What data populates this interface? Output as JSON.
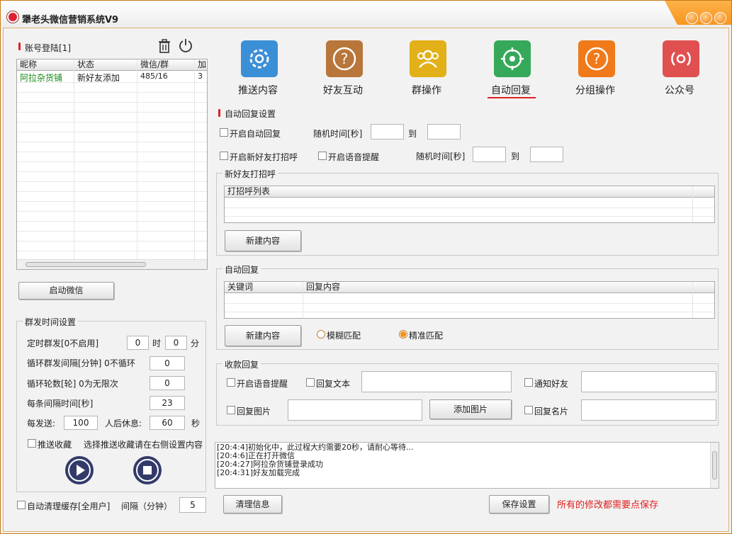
{
  "window": {
    "title": "犟老头微信营销系统V9"
  },
  "account": {
    "title": "账号登陆[1]",
    "columns": [
      "昵称",
      "状态",
      "微信/群",
      "加"
    ],
    "rows": [
      {
        "name": "阿拉杂货铺",
        "status": "新好友添加",
        "count": "485/16",
        "extra": "3"
      }
    ],
    "start_label": "启动微信"
  },
  "broadcast": {
    "title": "群发时间设置",
    "timed_label": "定时群发[0不启用]",
    "hour_value": "0",
    "hour_unit": "时",
    "min_value": "0",
    "min_unit": "分",
    "interval_label": "循环群发间隔[分钟] 0不循环",
    "interval_value": "0",
    "rounds_label": "循环轮数[轮] 0为无限次",
    "rounds_value": "0",
    "gap_label": "每条间隔时间[秒]",
    "gap_value": "23",
    "send_label": "每发送:",
    "send_value": "100",
    "rest_label": "人后休息:",
    "rest_value": "60",
    "rest_unit": "秒",
    "fav_label": "推送收藏",
    "fav_hint": "选择推送收藏请在右侧设置内容"
  },
  "cache": {
    "label": "自动清理缓存[全用户]",
    "interval_label": "间隔（分钟）",
    "interval_value": "5"
  },
  "tabs": [
    {
      "label": "推送内容",
      "color": "#3b8fd6",
      "icon": "gear-icon"
    },
    {
      "label": "好友互动",
      "color": "#b8763a",
      "icon": "question-icon"
    },
    {
      "label": "群操作",
      "color": "#e2b018",
      "icon": "group-icon"
    },
    {
      "label": "自动回复",
      "color": "#36a85a",
      "icon": "target-icon"
    },
    {
      "label": "分组操作",
      "color": "#f07a1a",
      "icon": "question-icon"
    },
    {
      "label": "公众号",
      "color": "#e05050",
      "icon": "broadcast-icon"
    }
  ],
  "auto_reply": {
    "section_title": "自动回复设置",
    "enable_label": "开启自动回复",
    "random_label": "随机时间[秒]",
    "to_label": "到",
    "greet_label": "开启新好友打招呼",
    "voice_label": "开启语音提醒",
    "random2_label": "随机时间[秒]",
    "to2_label": "到",
    "greet_group": "新好友打招呼",
    "greet_col": "打招呼列表",
    "greet_new": "新建内容",
    "reply_group": "自动回复",
    "kw_col": "关键词",
    "reply_col": "回复内容",
    "reply_new": "新建内容",
    "fuzzy_label": "模糊匹配",
    "exact_label": "精准匹配",
    "pay_group": "收款回复",
    "pay_voice": "开启语音提醒",
    "pay_text": "回复文本",
    "pay_notify": "通知好友",
    "pay_image": "回复图片",
    "pay_add_image": "添加图片",
    "pay_card": "回复名片"
  },
  "log": {
    "lines": [
      "[20:4:4]初始化中，此过程大约需要20秒，请耐心等待...",
      "[20:4:6]正在打开微信",
      "[20:4:27]阿拉杂货铺登录成功",
      "[20:4:31]好友加载完成"
    ]
  },
  "footer": {
    "clear_label": "清理信息",
    "save_label": "保存设置",
    "save_hint": "所有的修改都需要点保存",
    "hint_color": "#e02020"
  }
}
